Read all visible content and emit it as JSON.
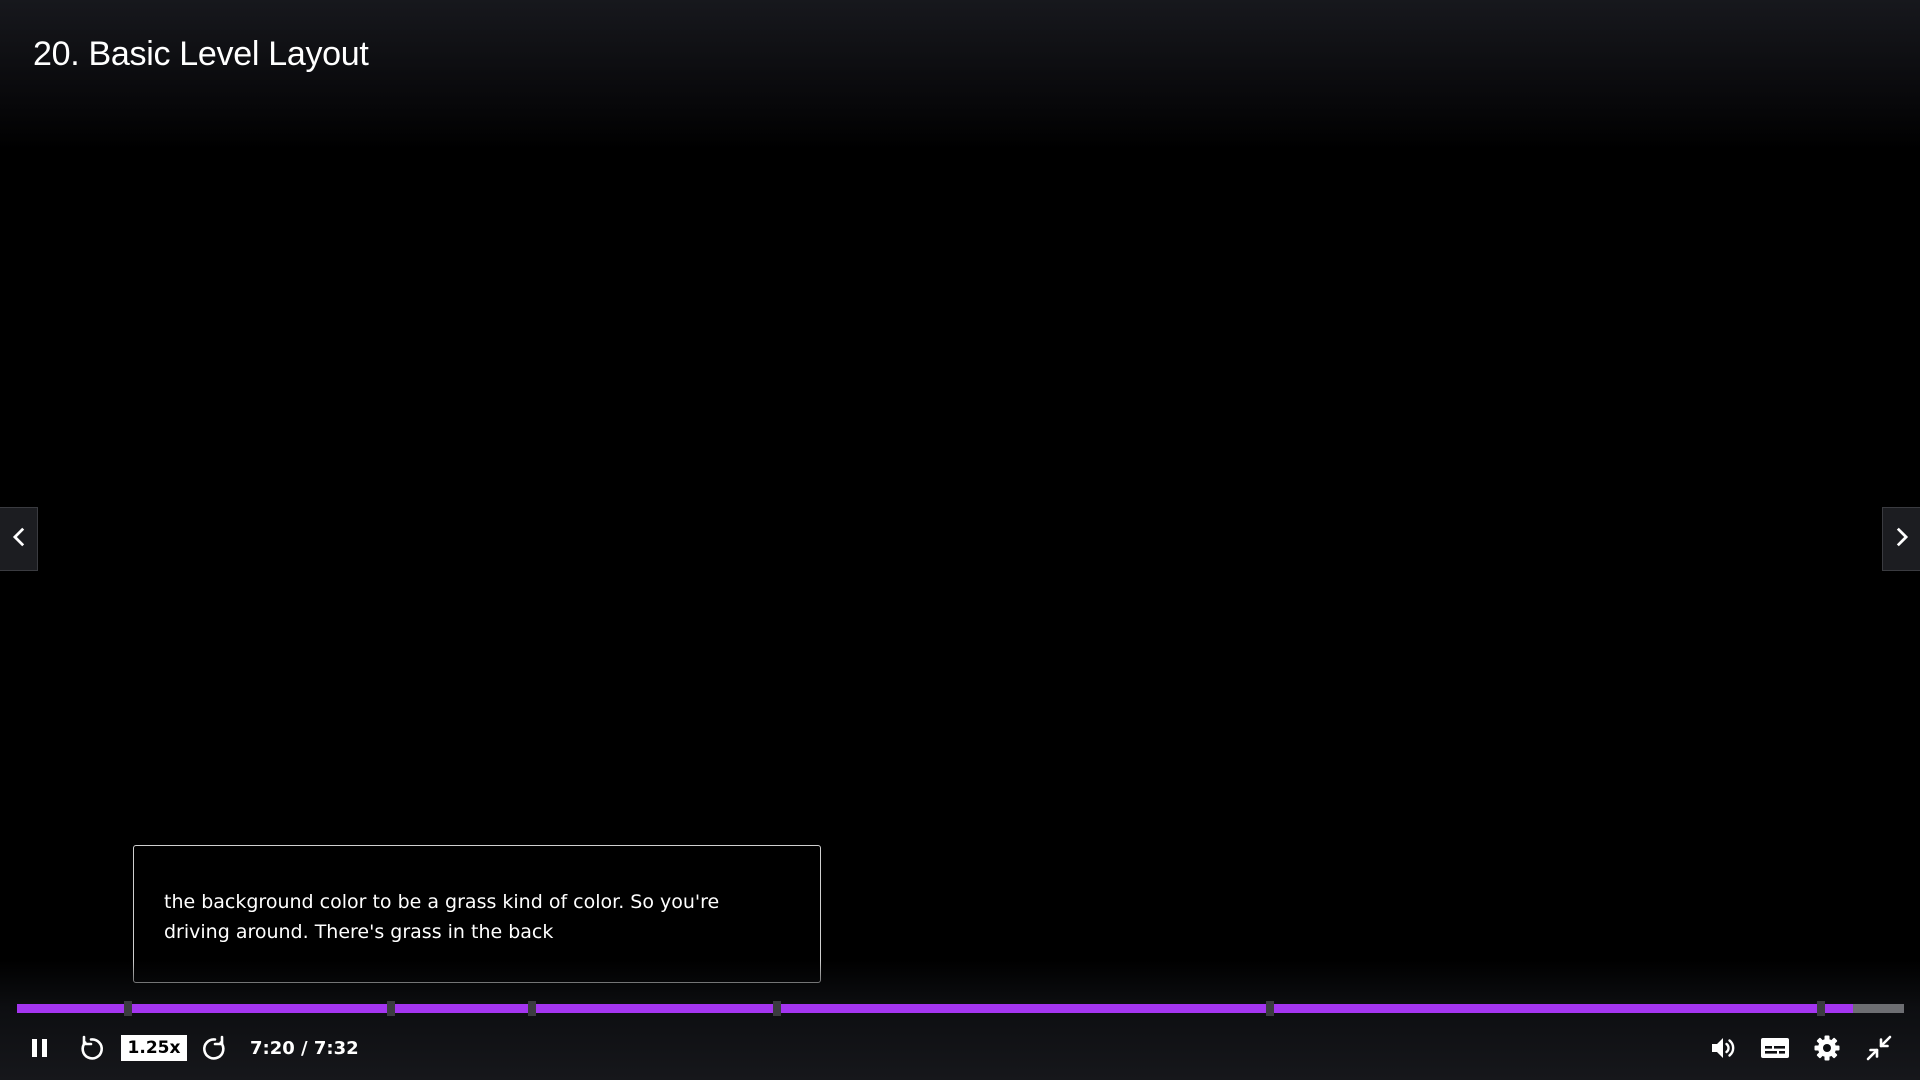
{
  "player": {
    "lecture_title": "20. Basic Level Layout",
    "caption_text": "the background color to be a grass kind of color. So you're driving around. There's grass in the back",
    "progress_fraction": 0.973,
    "chapter_markers": [
      0.059,
      0.198,
      0.273,
      0.403,
      0.664,
      0.956
    ],
    "playback_rate": "1.25x",
    "time_display": "7:20 / 7:32",
    "current_time": "7:20",
    "duration": "7:32",
    "accent_color": "#a435f0",
    "icons": {
      "prev": "chevron-left-icon",
      "next": "chevron-right-icon",
      "pause": "pause-icon",
      "rewind": "rewind-icon",
      "forward": "forward-icon",
      "volume": "volume-icon",
      "captions": "captions-icon",
      "settings": "gear-icon",
      "exit_fullscreen": "exit-fullscreen-icon"
    }
  }
}
